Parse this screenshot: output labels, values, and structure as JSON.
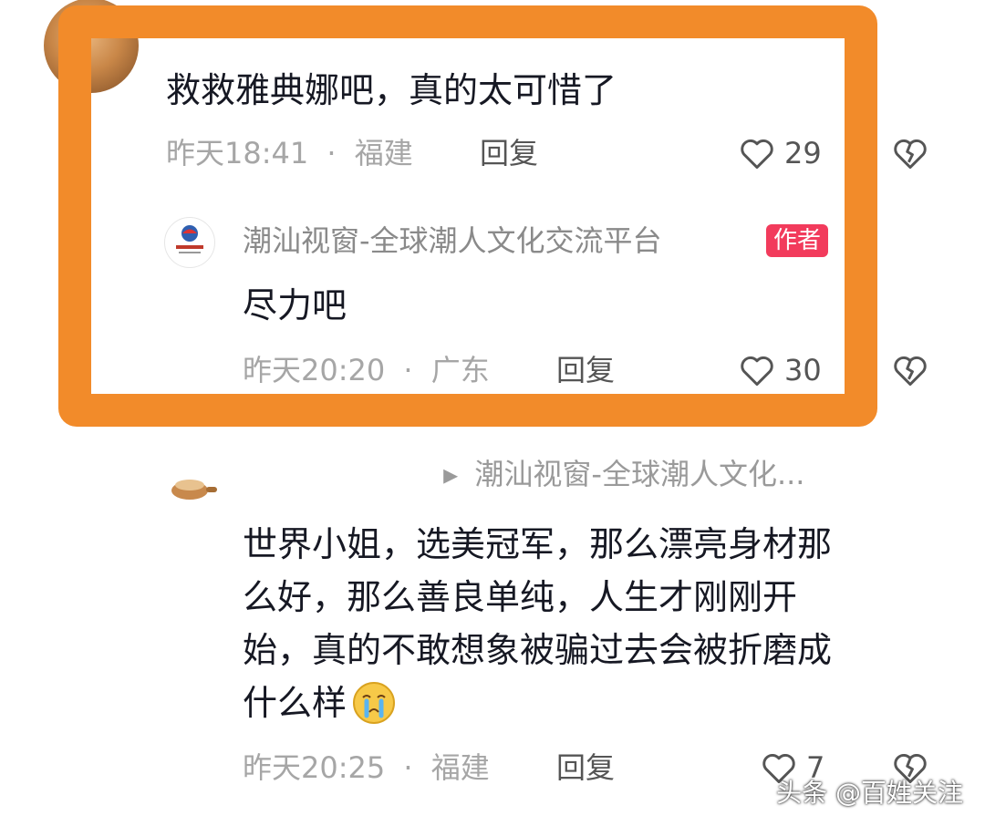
{
  "comment1": {
    "text": "救救雅典娜吧，真的太可惜了",
    "time": "昨天18:41",
    "separator": "·",
    "location": "福建",
    "reply_label": "回复",
    "likes": "29"
  },
  "reply1": {
    "author": "潮汕视窗-全球潮人文化交流平台",
    "badge": "作者",
    "avatar_text": "潮汕视窗",
    "text": "尽力吧",
    "time": "昨天20:20",
    "separator": "·",
    "location": "广东",
    "reply_label": "回复",
    "likes": "30"
  },
  "reply2": {
    "reply_to_arrow": "▸",
    "reply_to": "潮汕视窗-全球潮人文化...",
    "text_lines": [
      "世界小姐，选美冠军，那么漂亮身材那",
      "么好，那么善良单纯，人生才刚刚开",
      "始，真的不敢想象被骗过去会被折磨成",
      "什么样"
    ],
    "time": "昨天20:25",
    "separator": "·",
    "location": "福建",
    "reply_label": "回复",
    "likes": "7"
  },
  "watermark": "头条 @百姓关注",
  "colors": {
    "highlight": "#f28b2a",
    "badge": "#f23b5c",
    "meta": "#a6a6a6",
    "text": "#161823"
  },
  "icons": {
    "like": "heart-outline-icon",
    "dislike": "broken-heart-icon",
    "emoji": "crying-face-emoji"
  }
}
